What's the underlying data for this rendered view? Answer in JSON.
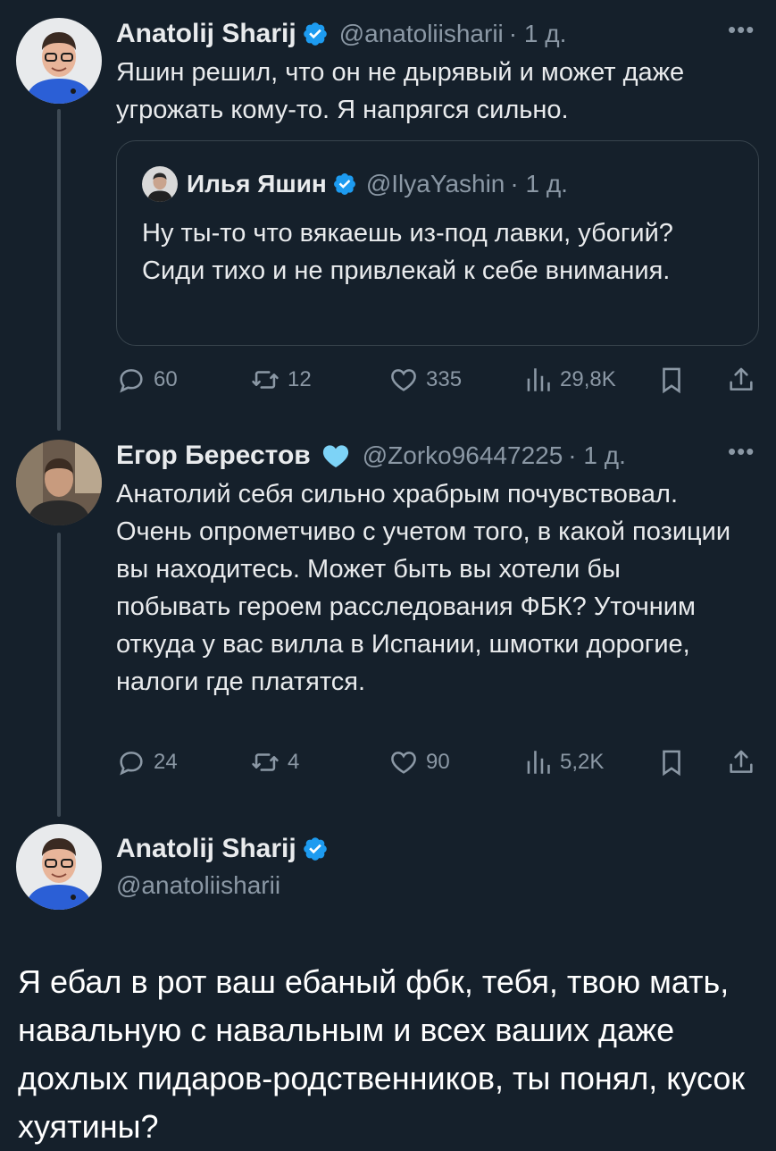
{
  "tweets": [
    {
      "name": "Anatolij Sharij",
      "handle": "@anatoliisharii",
      "time": "· 1 д.",
      "text": "Яшин решил, что он не дырявый и может даже угрожать кому-то. Я напрягся сильно.",
      "quote": {
        "name": "Илья Яшин",
        "handle": "@IlyaYashin",
        "time": "· 1 д.",
        "text": "Ну ты-то что вякаешь из-под лавки, убогий? Сиди тихо и не привлекай к себе внимания."
      },
      "stats": {
        "replies": "60",
        "retweets": "12",
        "likes": "335",
        "views": "29,8K"
      }
    },
    {
      "name": "Егор Берестов",
      "handle": "@Zorko96447225",
      "time": "· 1 д.",
      "text": "Анатолий себя сильно храбрым почувствовал. Очень опрометчиво с учетом того, в какой позиции вы находитесь. Может быть вы хотели бы побывать героем расследования ФБК? Уточним откуда у вас вилла в Испании, шмотки дорогие, налоги где платятся.",
      "stats": {
        "replies": "24",
        "retweets": "4",
        "likes": "90",
        "views": "5,2K"
      }
    }
  ],
  "main_tweet": {
    "name": "Anatolij Sharij",
    "handle": "@anatoliisharii",
    "text": "Я ебал в рот ваш ебаный фбк, тебя, твою мать, навальную с навальным и всех ваших даже дохлых пидаров-родственников, ты понял, кусок хуятины?"
  },
  "colors": {
    "background": "#15202b",
    "verified": "#1d9bf0",
    "muted": "#8b98a5",
    "heart_emoji": "#7dd3f7"
  },
  "icons": [
    "verified-badge-icon",
    "light-blue-heart-icon",
    "more-icon",
    "reply-icon",
    "retweet-icon",
    "like-icon",
    "views-icon",
    "bookmark-icon",
    "share-icon"
  ]
}
